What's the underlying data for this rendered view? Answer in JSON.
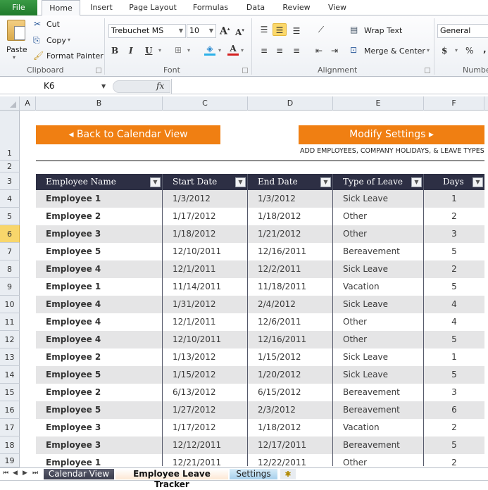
{
  "ribbon": {
    "tabs": [
      "File",
      "Home",
      "Insert",
      "Page Layout",
      "Formulas",
      "Data",
      "Review",
      "View"
    ],
    "active_tab": "Home",
    "clipboard": {
      "label": "Clipboard",
      "paste": "Paste",
      "cut": "Cut",
      "copy": "Copy",
      "format_painter": "Format Painter"
    },
    "font": {
      "label": "Font",
      "font_name": "Trebuchet MS",
      "font_size": "10",
      "bold": "B",
      "italic": "I",
      "underline": "U"
    },
    "alignment": {
      "label": "Alignment",
      "wrap_text": "Wrap Text",
      "merge_center": "Merge & Center"
    },
    "number": {
      "label": "Number",
      "format": "General",
      "currency": "$",
      "percent": "%"
    }
  },
  "formula_bar": {
    "name_box": "K6",
    "fx": "fx",
    "formula": ""
  },
  "columns": [
    "A",
    "B",
    "C",
    "D",
    "E",
    "F"
  ],
  "rows": [
    "1",
    "2",
    "3",
    "4",
    "5",
    "6",
    "7",
    "8",
    "9",
    "10",
    "11",
    "12",
    "13",
    "14",
    "15",
    "16",
    "17",
    "18",
    "19"
  ],
  "selected_row": "6",
  "sheet": {
    "back_button": "◂ Back to Calendar View",
    "modify_button": "Modify Settings ▸",
    "modify_note": "ADD EMPLOYEES, COMPANY HOLIDAYS, & LEAVE TYPES",
    "accent_color": "#f07f12",
    "header_color": "#2d2f44",
    "table": {
      "headers": [
        "Employee Name",
        "Start Date",
        "End Date",
        "Type of Leave",
        "Days"
      ],
      "rows": [
        [
          "Employee 1",
          "1/3/2012",
          "1/3/2012",
          "Sick Leave",
          "1"
        ],
        [
          "Employee 2",
          "1/17/2012",
          "1/18/2012",
          "Other",
          "2"
        ],
        [
          "Employee 3",
          "1/18/2012",
          "1/21/2012",
          "Other",
          "3"
        ],
        [
          "Employee 5",
          "12/10/2011",
          "12/16/2011",
          "Bereavement",
          "5"
        ],
        [
          "Employee 4",
          "12/1/2011",
          "12/2/2011",
          "Sick Leave",
          "2"
        ],
        [
          "Employee 1",
          "11/14/2011",
          "11/18/2011",
          "Vacation",
          "5"
        ],
        [
          "Employee 4",
          "1/31/2012",
          "2/4/2012",
          "Sick Leave",
          "4"
        ],
        [
          "Employee 4",
          "12/1/2011",
          "12/6/2011",
          "Other",
          "4"
        ],
        [
          "Employee 4",
          "12/10/2011",
          "12/16/2011",
          "Other",
          "5"
        ],
        [
          "Employee 2",
          "1/13/2012",
          "1/15/2012",
          "Sick Leave",
          "1"
        ],
        [
          "Employee 5",
          "1/15/2012",
          "1/20/2012",
          "Sick Leave",
          "5"
        ],
        [
          "Employee 2",
          "6/13/2012",
          "6/15/2012",
          "Bereavement",
          "3"
        ],
        [
          "Employee 5",
          "1/27/2012",
          "2/3/2012",
          "Bereavement",
          "6"
        ],
        [
          "Employee 3",
          "1/17/2012",
          "1/18/2012",
          "Vacation",
          "2"
        ],
        [
          "Employee 3",
          "12/12/2011",
          "12/17/2011",
          "Bereavement",
          "5"
        ],
        [
          "Employee 1",
          "12/21/2011",
          "12/22/2011",
          "Other",
          "2"
        ]
      ]
    }
  },
  "sheet_tabs": {
    "tabs": [
      "Calendar View",
      "Employee Leave Tracker",
      "Settings"
    ],
    "active": "Employee Leave Tracker",
    "new_sheet_icon": "new-sheet-icon"
  }
}
